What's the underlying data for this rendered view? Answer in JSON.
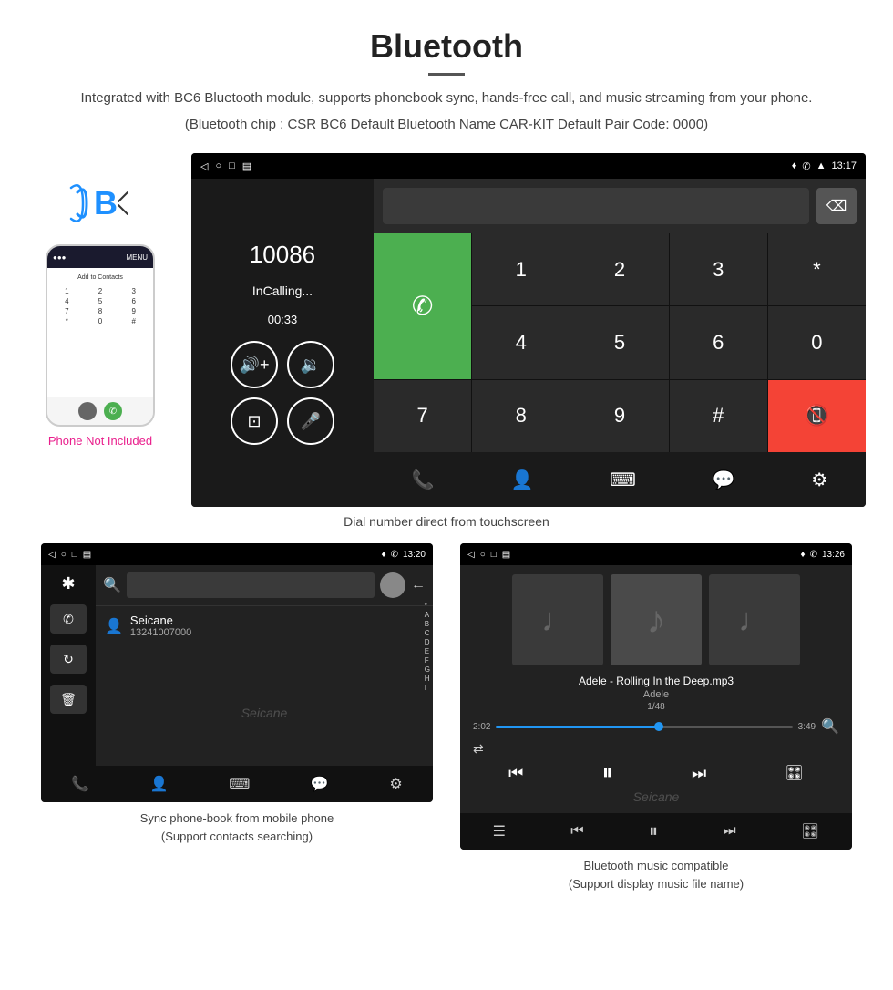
{
  "header": {
    "title": "Bluetooth",
    "description": "Integrated with BC6 Bluetooth module, supports phonebook sync, hands-free call, and music streaming from your phone.",
    "specs": "(Bluetooth chip : CSR BC6    Default Bluetooth Name CAR-KIT    Default Pair Code: 0000)"
  },
  "dial_screen": {
    "status_time": "13:17",
    "number": "10086",
    "in_calling": "InCalling...",
    "timer": "00:33",
    "keys": [
      "1",
      "2",
      "3",
      "*",
      "4",
      "5",
      "6",
      "0",
      "7",
      "8",
      "9",
      "#"
    ],
    "caption": "Dial number direct from touchscreen"
  },
  "phonebook_screen": {
    "time": "13:20",
    "contact_name": "Seicane",
    "contact_number": "13241007000",
    "alpha_list": [
      "*",
      "A",
      "B",
      "C",
      "D",
      "E",
      "F",
      "G",
      "H",
      "I"
    ],
    "caption_line1": "Sync phone-book from mobile phone",
    "caption_line2": "(Support contacts searching)"
  },
  "music_screen": {
    "time": "13:26",
    "track_name": "Adele - Rolling In the Deep.mp3",
    "artist": "Adele",
    "counter": "1/48",
    "time_current": "2:02",
    "time_total": "3:49",
    "caption_line1": "Bluetooth music compatible",
    "caption_line2": "(Support display music file name)"
  },
  "phone_aside": {
    "not_included": "Phone Not Included"
  }
}
